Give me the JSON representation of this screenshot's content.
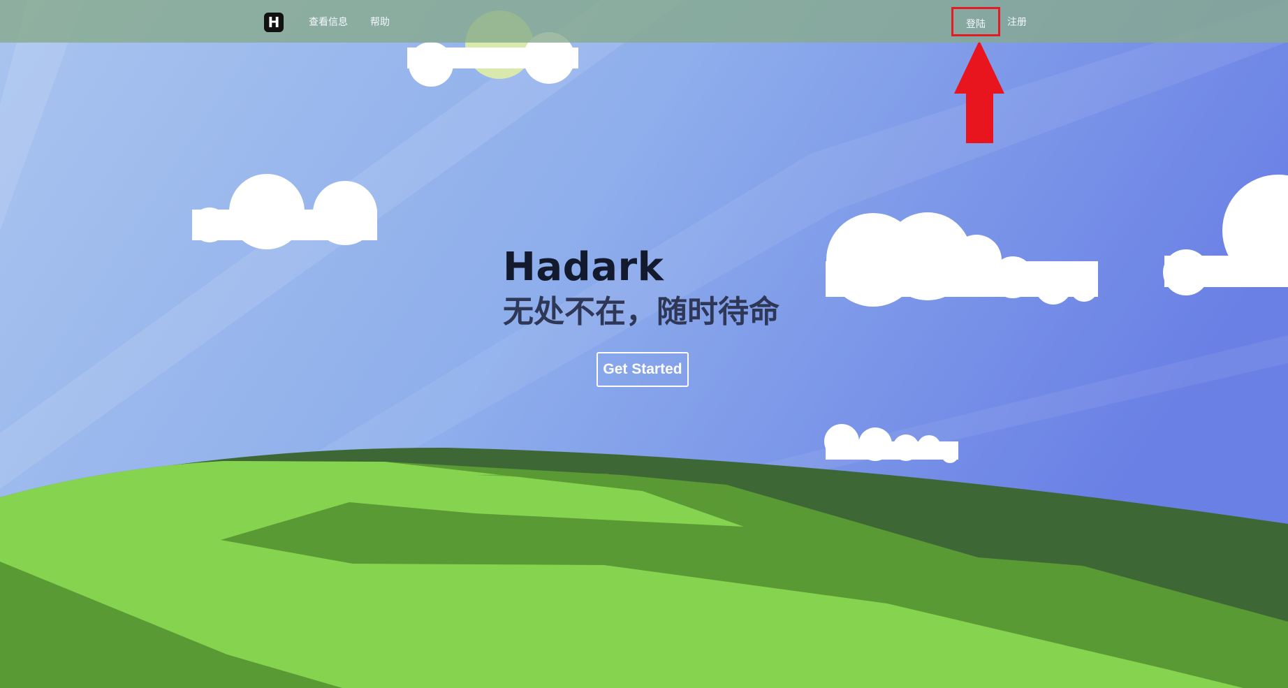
{
  "navbar": {
    "logo_letter": "H",
    "links": {
      "view_info": "查看信息",
      "help": "帮助",
      "login": "登陆",
      "register": "注册"
    }
  },
  "hero": {
    "title": "Hadark",
    "subtitle": "无处不在，随时待命",
    "cta_label": "Get Started"
  },
  "colors": {
    "sky_light": "#a7c3ee",
    "sky_dark": "#6b82e6",
    "grass_light": "#86d350",
    "grass_mid": "#5a9a34",
    "grass_dark": "#3d6835",
    "annotation_red": "#e21b24",
    "navbar": "#87aa8c"
  },
  "annotation": {
    "icon": "red-arrow-up-icon"
  }
}
